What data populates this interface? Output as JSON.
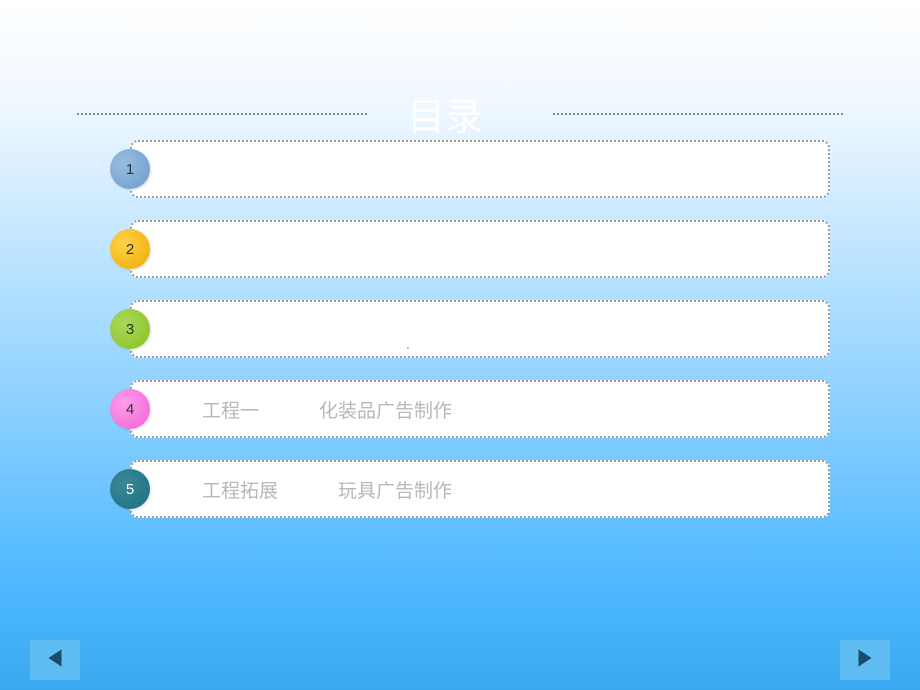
{
  "title": "目录",
  "toc": {
    "items": [
      {
        "num": "1",
        "label": "",
        "desc": "",
        "circleClass": "circle-1"
      },
      {
        "num": "2",
        "label": "",
        "desc": "",
        "circleClass": "circle-2"
      },
      {
        "num": "3",
        "label": "",
        "desc": "",
        "circleClass": "circle-3"
      },
      {
        "num": "4",
        "label": "工程一",
        "desc": "化装品广告制作",
        "circleClass": "circle-4"
      },
      {
        "num": "5",
        "label": "工程拓展",
        "desc": "玩具广告制作",
        "circleClass": "circle-5"
      }
    ]
  },
  "centerDot": "."
}
